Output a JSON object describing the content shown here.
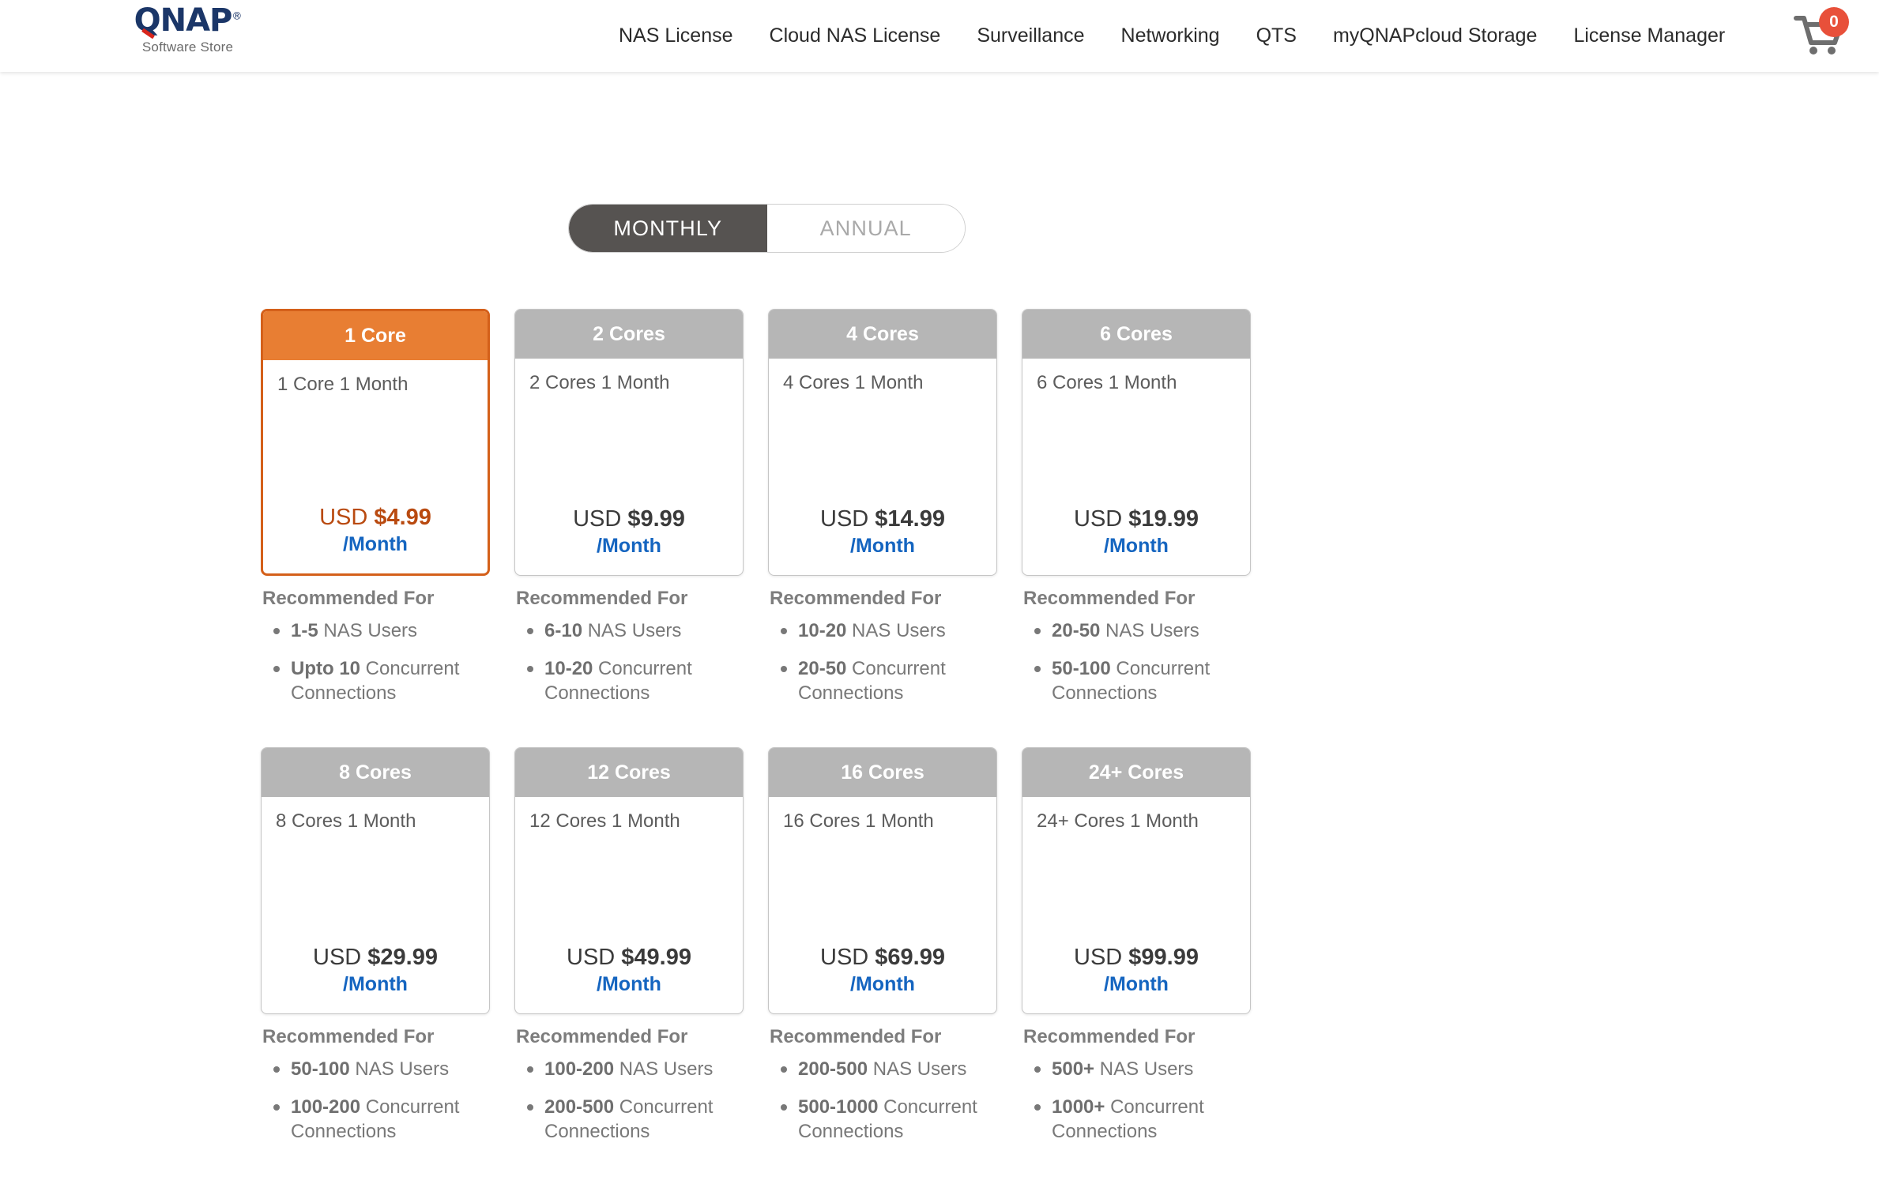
{
  "header": {
    "brand_mark": "QNAP",
    "brand_reg": "®",
    "brand_sub": "Software Store",
    "nav": [
      {
        "label": "NAS License"
      },
      {
        "label": "Cloud NAS License"
      },
      {
        "label": "Surveillance"
      },
      {
        "label": "Networking"
      },
      {
        "label": "QTS"
      },
      {
        "label": "myQNAPcloud Storage"
      },
      {
        "label": "License Manager"
      }
    ],
    "cart": {
      "count": "0",
      "icon": "shopping-cart-icon"
    }
  },
  "billing_toggle": {
    "options": [
      {
        "label": "MONTHLY",
        "active": true
      },
      {
        "label": "ANNUAL",
        "active": false
      }
    ]
  },
  "colors": {
    "accent_orange": "#e87e33",
    "accent_orange_border": "#d4601a",
    "price_orange": "#b94a10",
    "header_gray": "#b6b6b6",
    "toggle_dark": "#565351",
    "period_blue": "#1565c0",
    "badge_red": "#e8503a",
    "brand_navy": "#1b3668"
  },
  "rec_label": "Recommended For",
  "plans": [
    {
      "id": "1-core",
      "title": "1 Core",
      "description": "1 Core 1 Month",
      "currency": "USD",
      "price": "$4.99",
      "period": "/Month",
      "selected": true,
      "recommended": [
        {
          "strong": "1-5",
          "rest": " NAS Users"
        },
        {
          "strong": "Upto 10",
          "rest": " Concurrent Connections"
        }
      ]
    },
    {
      "id": "2-cores",
      "title": "2 Cores",
      "description": "2 Cores 1 Month",
      "currency": "USD",
      "price": "$9.99",
      "period": "/Month",
      "selected": false,
      "recommended": [
        {
          "strong": "6-10",
          "rest": " NAS Users"
        },
        {
          "strong": "10-20",
          "rest": " Concurrent Connections"
        }
      ]
    },
    {
      "id": "4-cores",
      "title": "4 Cores",
      "description": "4 Cores 1 Month",
      "currency": "USD",
      "price": "$14.99",
      "period": "/Month",
      "selected": false,
      "recommended": [
        {
          "strong": "10-20",
          "rest": " NAS Users"
        },
        {
          "strong": "20-50",
          "rest": " Concurrent Connections"
        }
      ]
    },
    {
      "id": "6-cores",
      "title": "6 Cores",
      "description": "6 Cores 1 Month",
      "currency": "USD",
      "price": "$19.99",
      "period": "/Month",
      "selected": false,
      "recommended": [
        {
          "strong": "20-50",
          "rest": " NAS Users"
        },
        {
          "strong": "50-100",
          "rest": " Concurrent Connections"
        }
      ]
    },
    {
      "id": "8-cores",
      "title": "8 Cores",
      "description": "8 Cores 1 Month",
      "currency": "USD",
      "price": "$29.99",
      "period": "/Month",
      "selected": false,
      "recommended": [
        {
          "strong": "50-100",
          "rest": " NAS Users"
        },
        {
          "strong": "100-200",
          "rest": " Concurrent Connections"
        }
      ]
    },
    {
      "id": "12-cores",
      "title": "12 Cores",
      "description": "12 Cores 1 Month",
      "currency": "USD",
      "price": "$49.99",
      "period": "/Month",
      "selected": false,
      "recommended": [
        {
          "strong": "100-200",
          "rest": " NAS Users"
        },
        {
          "strong": "200-500",
          "rest": " Concurrent Connections"
        }
      ]
    },
    {
      "id": "16-cores",
      "title": "16 Cores",
      "description": "16 Cores 1 Month",
      "currency": "USD",
      "price": "$69.99",
      "period": "/Month",
      "selected": false,
      "recommended": [
        {
          "strong": "200-500",
          "rest": " NAS Users"
        },
        {
          "strong": "500-1000",
          "rest": " Concurrent Connections"
        }
      ]
    },
    {
      "id": "24-plus-cores",
      "title": "24+ Cores",
      "description": "24+ Cores 1 Month",
      "currency": "USD",
      "price": "$99.99",
      "period": "/Month",
      "selected": false,
      "recommended": [
        {
          "strong": "500+",
          "rest": " NAS Users"
        },
        {
          "strong": "1000+",
          "rest": " Concurrent Connections"
        }
      ]
    }
  ]
}
